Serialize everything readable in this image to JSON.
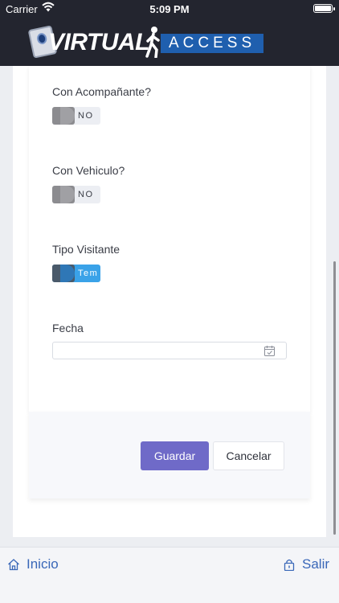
{
  "status_bar": {
    "carrier": "Carrier",
    "time": "5:09 PM"
  },
  "header": {
    "logo_word": "VIRTUAL",
    "logo_sub": "ACCESS"
  },
  "form": {
    "companion": {
      "label": "Con Acompañante?",
      "toggle_text": "NO",
      "value": false
    },
    "vehicle": {
      "label": "Con Vehiculo?",
      "toggle_text": "NO",
      "value": false
    },
    "visitor_type": {
      "label": "Tipo Visitante",
      "toggle_text": "Tem",
      "value": true
    },
    "date": {
      "label": "Fecha",
      "value": ""
    }
  },
  "actions": {
    "save_label": "Guardar",
    "cancel_label": "Cancelar"
  },
  "tabbar": {
    "home_label": "Inicio",
    "logout_label": "Salir"
  },
  "colors": {
    "header_bg": "#23252f",
    "accent": "#6f6ac8",
    "toggle_on": "#3aa2e8",
    "link": "#3967b8"
  },
  "icons": [
    "wifi-icon",
    "battery-icon",
    "calendar-icon",
    "home-icon",
    "lock-icon"
  ]
}
